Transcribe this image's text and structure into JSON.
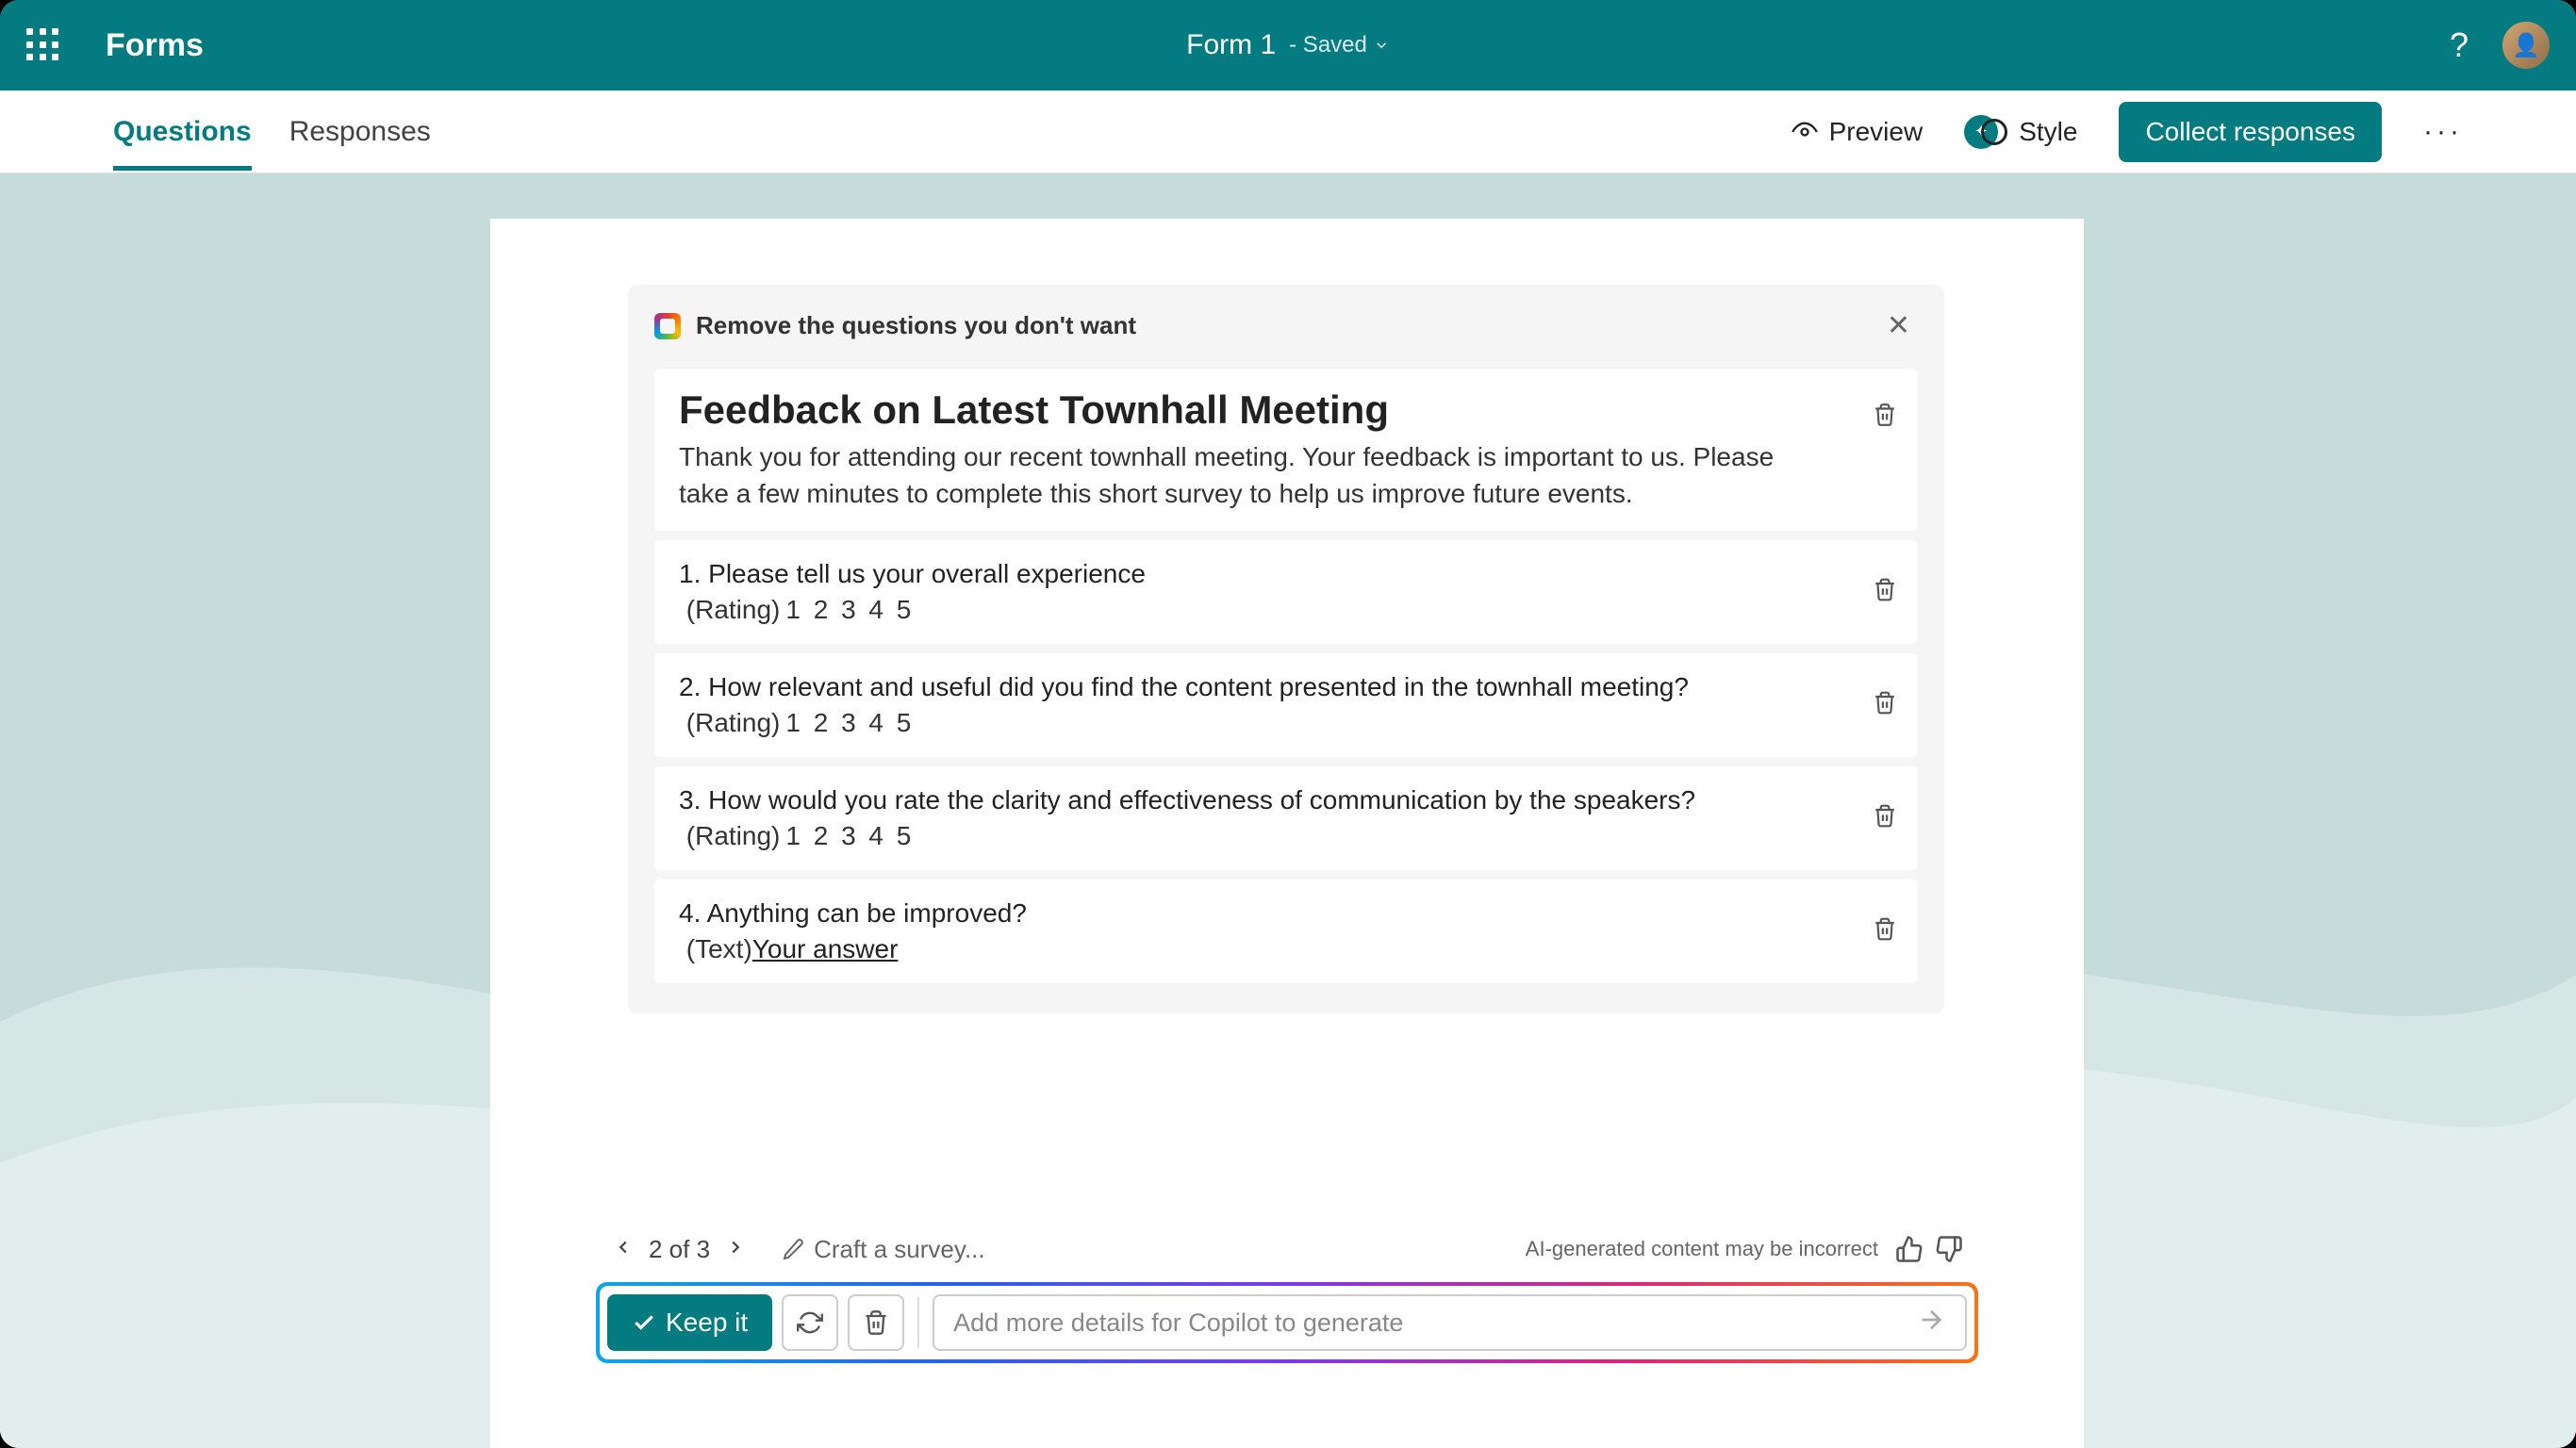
{
  "header": {
    "brand": "Forms",
    "form_title": "Form 1",
    "saved_label": "- Saved"
  },
  "tabs": {
    "questions": "Questions",
    "responses": "Responses"
  },
  "toolbar": {
    "preview": "Preview",
    "style": "Style",
    "collect": "Collect responses"
  },
  "draft": {
    "hint": "Remove the questions you don't want",
    "title": "Feedback on Latest Townhall Meeting",
    "description": "Thank you for attending our recent townhall meeting. Your feedback is important to us. Please take a few minutes to complete this short survey to help us improve future events."
  },
  "questions": [
    {
      "num": "1.",
      "text": "Please tell us your overall experience",
      "type_label": "(Rating)",
      "scale": "1   2   3   4   5"
    },
    {
      "num": "2.",
      "text": "How relevant and useful did you find the content presented in the townhall meeting?",
      "type_label": "(Rating)",
      "scale": "1   2   3   4   5"
    },
    {
      "num": "3.",
      "text": "How would you rate the clarity and effectiveness of communication by the speakers?",
      "type_label": "(Rating)",
      "scale": "1   2   3   4   5"
    },
    {
      "num": "4.",
      "text": "Anything can be improved?",
      "type_label": "(Text)",
      "answer_placeholder": "Your answer"
    }
  ],
  "nav": {
    "counter": "2 of 3",
    "craft": "Craft a survey...",
    "ai_note": "AI-generated content may be incorrect"
  },
  "actions": {
    "keep": "Keep it",
    "prompt_placeholder": "Add more details for Copilot to generate"
  }
}
